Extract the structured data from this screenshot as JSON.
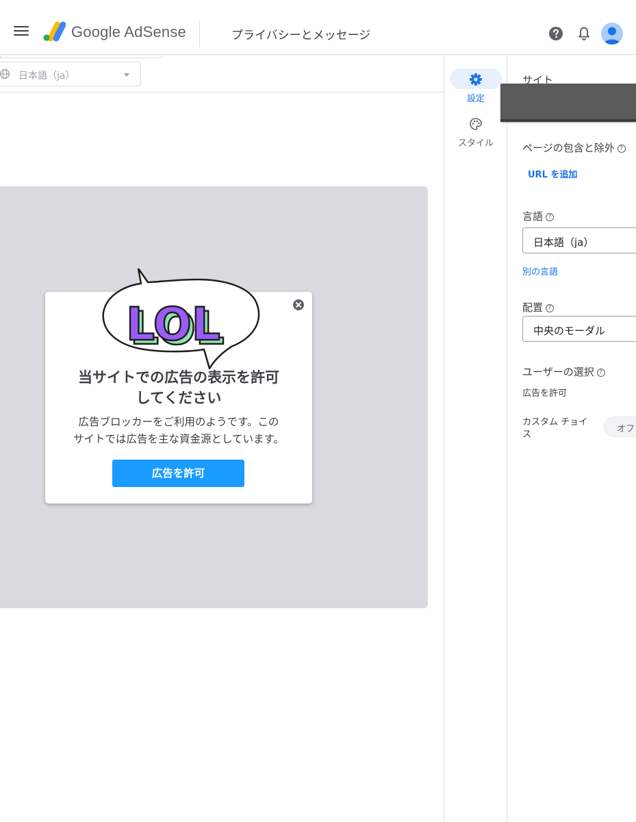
{
  "header": {
    "brand_google": "Google",
    "brand_product": "AdSense",
    "page_title": "プライバシーとメッセージ"
  },
  "icons": {
    "menu": "menu-icon",
    "help": "help-icon",
    "notifications": "bell-icon",
    "globe": "globe-icon",
    "settings": "gear-icon",
    "style": "palette-icon",
    "close": "close-icon"
  },
  "preview": {
    "language_value": "日本語（ja）",
    "message": {
      "headline_line1": "当サイトでの広告の表示を許可",
      "headline_line2": "してください",
      "body_line1": "広告ブロッカーをご利用のようです。この",
      "body_line2": "サイトでは広告を主な資金源としています。",
      "button_label": "広告を許可",
      "sticker_text": "LOL"
    }
  },
  "rail": {
    "items": [
      {
        "label": "設定",
        "active": true
      },
      {
        "label": "スタイル",
        "active": false
      }
    ]
  },
  "panel": {
    "site_label": "サイト",
    "inclusion_label": "ページの包含と除外",
    "add_url_link": "URL を追加",
    "language_label": "言語",
    "language_value": "日本語（ja）",
    "other_language_link": "別の言語",
    "placement_label": "配置",
    "placement_value": "中央のモーダル",
    "user_choice_label": "ユーザーの選択",
    "allow_ads_text": "広告を許可",
    "custom_choice_line1": "カスタム チョイ",
    "custom_choice_line2": "ス",
    "custom_choice_toggle": "オフ"
  },
  "colors": {
    "accent_blue": "#1a73e8",
    "button_blue": "#1a9bff",
    "canvas_grey": "#dadbe0",
    "lol_purple": "#9b5cf6",
    "lol_green": "#8fe3b0"
  }
}
